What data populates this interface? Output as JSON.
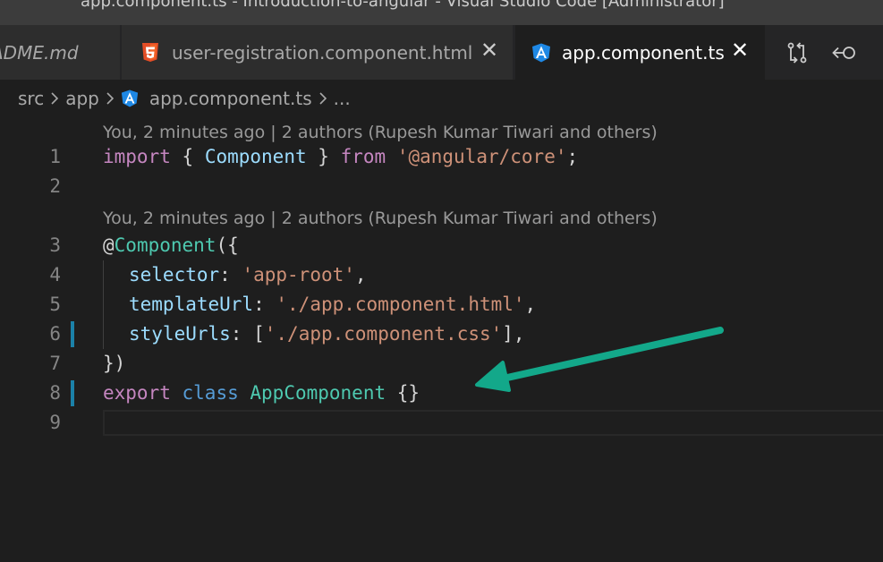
{
  "window": {
    "title": "app.component.ts - Introduction-to-angular - Visual Studio Code [Administrator]"
  },
  "tabs": [
    {
      "label": "ADME.md",
      "icon": "markdown-file-icon",
      "active": false
    },
    {
      "label": "user-registration.component.html",
      "icon": "html5-icon",
      "active": false,
      "close": "✕"
    },
    {
      "label": "app.component.ts",
      "icon": "angular-icon",
      "active": true,
      "close": "✕"
    }
  ],
  "tab_actions": [
    "compare-changes-icon",
    "go-back-icon"
  ],
  "breadcrumb": {
    "items": [
      "src",
      "app",
      "app.component.ts",
      "..."
    ]
  },
  "codelens": {
    "line1": "You, 2 minutes ago | 2 authors (Rupesh Kumar Tiwari and others)",
    "line3": "You, 2 minutes ago | 2 authors (Rupesh Kumar Tiwari and others)"
  },
  "line_numbers": [
    "1",
    "2",
    "3",
    "4",
    "5",
    "6",
    "7",
    "8",
    "9"
  ],
  "code": {
    "l1": {
      "import": "import",
      "ob": "{",
      "component": "Component",
      "cb": "}",
      "from": "from",
      "module": "'@angular/core'",
      "semi": ";"
    },
    "l3": {
      "at": "@",
      "decorator": "Component",
      "open": "({"
    },
    "l4": {
      "key": "selector",
      "colon": ":",
      "value": "'app-root'",
      "comma": ","
    },
    "l5": {
      "key": "templateUrl",
      "colon": ":",
      "value": "'./app.component.html'",
      "comma": ","
    },
    "l6": {
      "key": "styleUrls",
      "colon": ":",
      "ob": "[",
      "value": "'./app.component.css'",
      "cb": "],",
      "trail": ""
    },
    "l7": {
      "close": "})"
    },
    "l8": {
      "export": "export",
      "class": "class",
      "name": "AppComponent",
      "body": "{}"
    }
  },
  "modified_lines": [
    6,
    8
  ],
  "colors": {
    "arrow": "#13a88a",
    "gutter_modified": "#1b81a8",
    "angular": "#1e88e5",
    "html5": "#e44d26"
  }
}
